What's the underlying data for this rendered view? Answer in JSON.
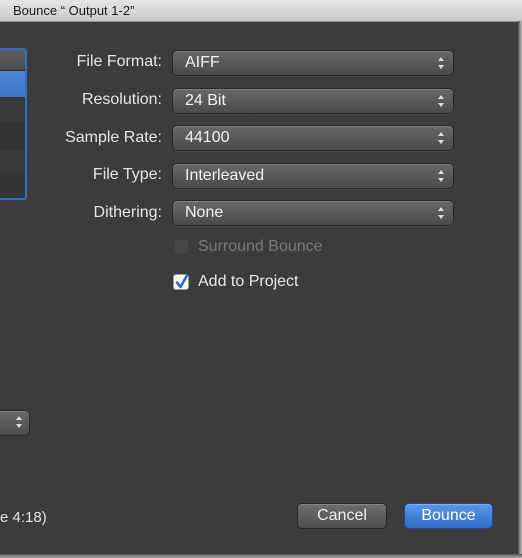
{
  "window": {
    "title": "Bounce “ Output 1-2”"
  },
  "left": {
    "status_text": "e 4:18)"
  },
  "form": {
    "file_format": {
      "label": "File Format:",
      "value": "AIFF"
    },
    "resolution": {
      "label": "Resolution:",
      "value": "24 Bit"
    },
    "sample_rate": {
      "label": "Sample Rate:",
      "value": "44100"
    },
    "file_type": {
      "label": "File Type:",
      "value": "Interleaved"
    },
    "dithering": {
      "label": "Dithering:",
      "value": "None"
    },
    "surround_bounce": {
      "label": "Surround Bounce",
      "checked": false,
      "enabled": false
    },
    "add_to_project": {
      "label": "Add to Project",
      "checked": true,
      "enabled": true
    }
  },
  "buttons": {
    "cancel": "Cancel",
    "bounce": "Bounce"
  },
  "icons": {
    "popup_arrows": "up-down-chevron-icon",
    "checkmark": "checkmark-icon"
  },
  "colors": {
    "background": "#3c3c3c",
    "accent": "#3f75c4",
    "default_button": "#2f6bc6"
  }
}
